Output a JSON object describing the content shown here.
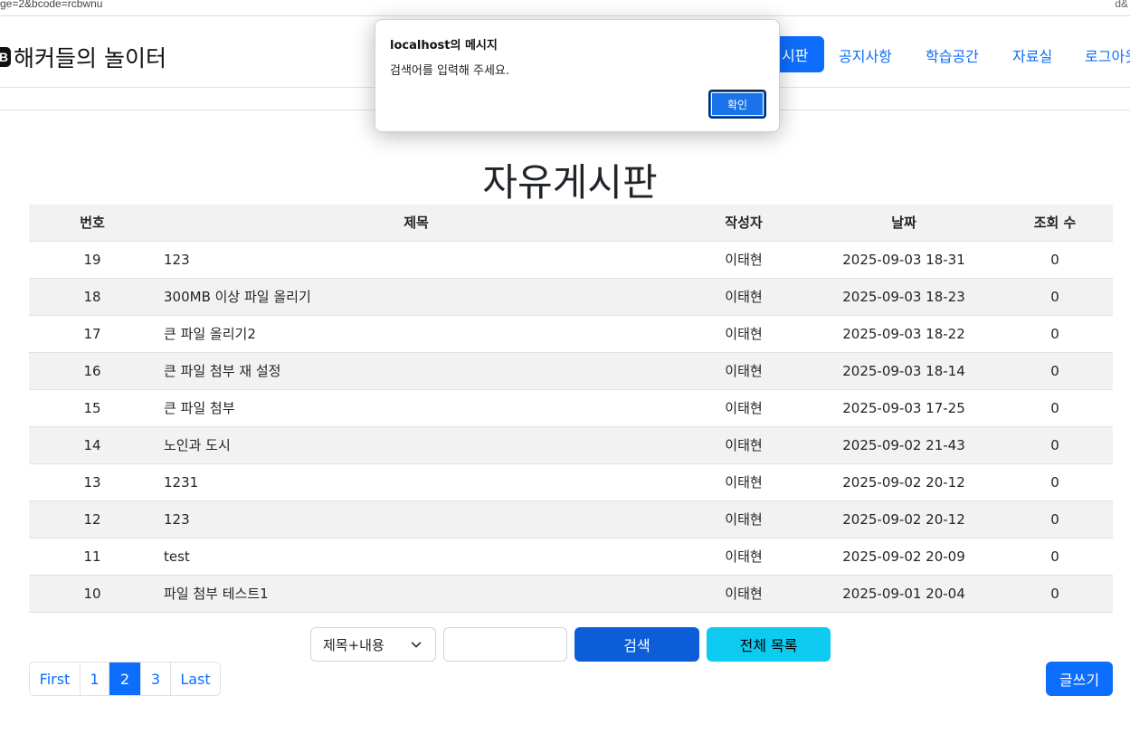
{
  "browser": {
    "url_fragment": "ge=2&bcode=rcbwnu",
    "right_fragment": "d&"
  },
  "navbar": {
    "logo_letter": "B",
    "brand": "해커들의 놀이터",
    "active_item": "시판",
    "items": [
      "공지사항",
      "학습공간",
      "자료실",
      "로그아웃"
    ]
  },
  "page": {
    "title": "자유게시판"
  },
  "table": {
    "headers": {
      "num": "번호",
      "title": "제목",
      "author": "작성자",
      "date": "날짜",
      "views": "조회 수"
    },
    "rows": [
      {
        "num": "19",
        "title": "123",
        "author": "이태현",
        "date": "2025-09-03 18-31",
        "views": "0"
      },
      {
        "num": "18",
        "title": "300MB 이상 파일 올리기",
        "author": "이태현",
        "date": "2025-09-03 18-23",
        "views": "0"
      },
      {
        "num": "17",
        "title": "큰 파일 올리기2",
        "author": "이태현",
        "date": "2025-09-03 18-22",
        "views": "0"
      },
      {
        "num": "16",
        "title": "큰 파일 첨부 재 설정",
        "author": "이태현",
        "date": "2025-09-03 18-14",
        "views": "0"
      },
      {
        "num": "15",
        "title": "큰 파일 첨부",
        "author": "이태현",
        "date": "2025-09-03 17-25",
        "views": "0"
      },
      {
        "num": "14",
        "title": "노인과 도시",
        "author": "이태현",
        "date": "2025-09-02 21-43",
        "views": "0"
      },
      {
        "num": "13",
        "title": "1231",
        "author": "이태현",
        "date": "2025-09-02 20-12",
        "views": "0"
      },
      {
        "num": "12",
        "title": "123",
        "author": "이태현",
        "date": "2025-09-02 20-12",
        "views": "0"
      },
      {
        "num": "11",
        "title": "test",
        "author": "이태현",
        "date": "2025-09-02 20-09",
        "views": "0"
      },
      {
        "num": "10",
        "title": "파일 첨부 테스트1",
        "author": "이태현",
        "date": "2025-09-01 20-04",
        "views": "0"
      }
    ]
  },
  "search": {
    "select_value": "제목+내용",
    "input_value": "",
    "search_label": "검색",
    "all_label": "전체 목록"
  },
  "pagination": {
    "items": [
      {
        "label": "First",
        "active": false
      },
      {
        "label": "1",
        "active": false
      },
      {
        "label": "2",
        "active": true
      },
      {
        "label": "3",
        "active": false
      },
      {
        "label": "Last",
        "active": false
      }
    ]
  },
  "write_button": "글쓰기",
  "alert": {
    "title": "localhost의 메시지",
    "message": "검색어를 입력해 주세요.",
    "ok_label": "확인"
  }
}
